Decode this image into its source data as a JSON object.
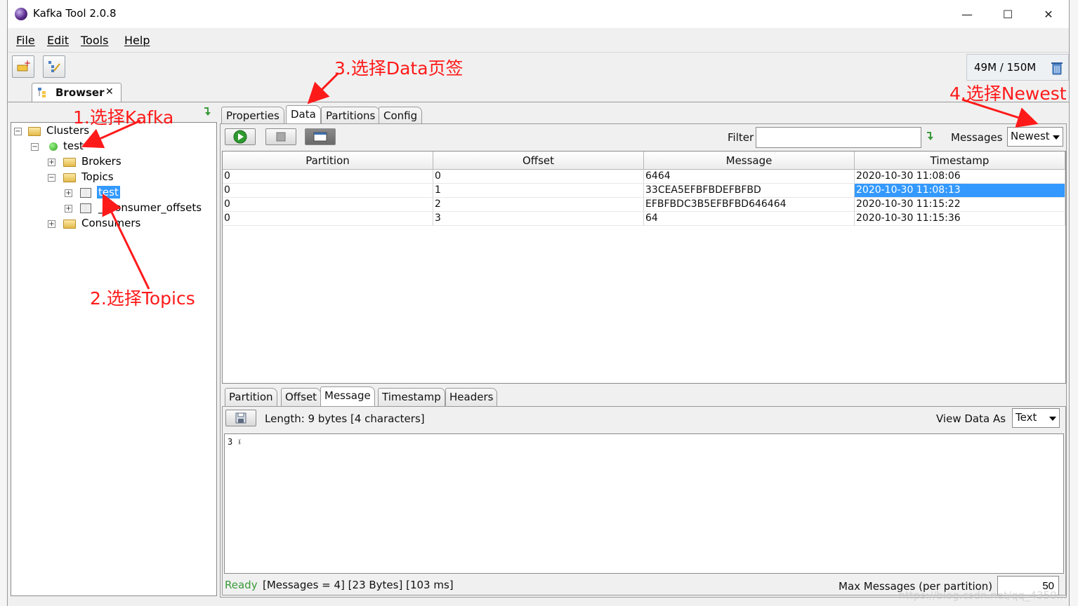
{
  "window": {
    "title": "Kafka Tool  2.0.8",
    "minimize": "—",
    "maximize": "☐",
    "close": "✕"
  },
  "menu": [
    "File",
    "Edit",
    "Tools",
    "Help"
  ],
  "memory": {
    "text": "49M / 150M"
  },
  "browser_tab": {
    "label": "Browser",
    "close": "✕"
  },
  "tree": {
    "clusters": "Clusters",
    "cluster_name": "test",
    "brokers": "Brokers",
    "topics": "Topics",
    "topic_test": "test",
    "topic_offsets": "__consumer_offsets",
    "consumers": "Consumers"
  },
  "panel_tabs": [
    "Properties",
    "Data",
    "Partitions",
    "Config"
  ],
  "data_toolbar": {
    "filter_label": "Filter",
    "filter_value": "",
    "messages_label": "Messages",
    "messages_value": "Newest"
  },
  "grid": {
    "columns": [
      "Partition",
      "Offset",
      "Message",
      "Timestamp"
    ],
    "rows": [
      {
        "partition": "0",
        "offset": "0",
        "message": "6464",
        "timestamp": "2020-10-30 11:08:06"
      },
      {
        "partition": "0",
        "offset": "1",
        "message": "33CEA5EFBFBDEFBFBD",
        "timestamp": "2020-10-30 11:08:13"
      },
      {
        "partition": "0",
        "offset": "2",
        "message": "EFBFBDC3B5EFBFBD646464",
        "timestamp": "2020-10-30 11:15:22"
      },
      {
        "partition": "0",
        "offset": "3",
        "message": "64",
        "timestamp": "2020-10-30 11:15:36"
      }
    ]
  },
  "detail_tabs": [
    "Partition",
    "Offset",
    "Message",
    "Timestamp",
    "Headers"
  ],
  "detail": {
    "length": "Length: 9 bytes [4 characters]",
    "view_as_label": "View Data As",
    "view_as_value": "Text",
    "content": "3 ፤"
  },
  "status": {
    "ready": "Ready",
    "info": "[Messages = 4]  [23 Bytes]  [103 ms]",
    "max_label": "Max Messages (per partition)",
    "max_value": "50"
  },
  "annotations": {
    "a1": "1.选择Kafka",
    "a2": "2.选择Topics",
    "a3": "3.选择Data页签",
    "a4": "4.选择Newest"
  },
  "watermark": "https://blog.csdn.net/qq_4350..."
}
